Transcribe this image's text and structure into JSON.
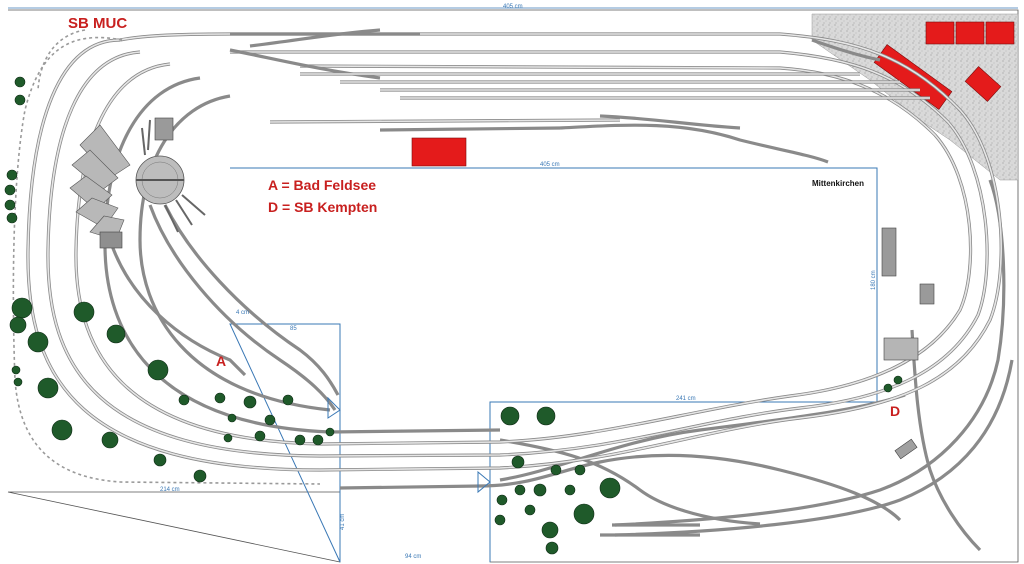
{
  "labels": {
    "sb_muc": "SB MUC",
    "legend_a": "A = Bad Feldsee",
    "legend_d": "D = SB Kempten",
    "marker_a": "A",
    "marker_d": "D",
    "station": "Mittenkirchen"
  },
  "dimensions": {
    "top": "405 cm",
    "inner_top": "405 cm",
    "inner_right": "180 cm",
    "lower_mid": "241 cm",
    "inner_left": "4 cm",
    "inner_small": "85",
    "bottom_left": "214 cm",
    "bottom_notch": "94 cm",
    "notch_side": "41 cm"
  },
  "colors": {
    "track": "#8a8a8a",
    "building": "#e41b1b",
    "tree": "#1f5a2a",
    "board": "#3a78b5",
    "label": "#c8201f"
  }
}
